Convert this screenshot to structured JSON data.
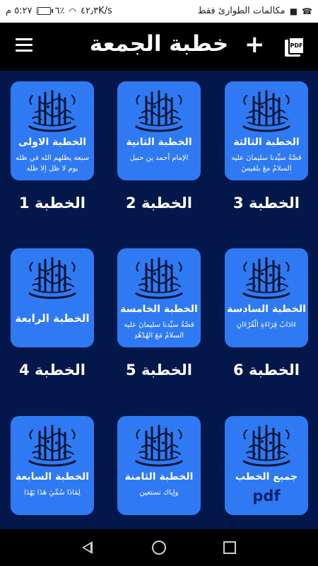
{
  "status_bar": {
    "carrier_text": "مكالمات الطوارئ فقط",
    "speed": "٤٢٫٣K/s",
    "battery": "٦٪",
    "battery_level": 0.06,
    "time": "٥:٢٧ م"
  },
  "app_bar": {
    "title": "خطبة الجمعة",
    "plus_label": "+",
    "pdf_label": "PDF"
  },
  "cards": [
    {
      "title": "الخطبة الاولى",
      "subtitle": "سبعة يظلهم الله في ظله يوم لا ظل إلا ظله",
      "caption": "الخطبة 1"
    },
    {
      "title": "الخطبة الثانية",
      "subtitle": "الإمام أحمد بن حنبل",
      "caption": "الخطبة 2"
    },
    {
      "title": "الخطبة الثالثة",
      "subtitle": "قصَّةُ سيِّدنا سليمانَ عليه السلامُ معَ بلقيسَ",
      "caption": "الخطبة 3"
    },
    {
      "title": "الخطبة الرابعة",
      "subtitle": "",
      "caption": "الخطبة 4"
    },
    {
      "title": "الخطبة الخامسة",
      "subtitle": "قصَّةُ سيِّدنا سليمانَ عليه السلامُ مَعَ الهُدْهُدِ",
      "caption": "الخطبة 5"
    },
    {
      "title": "الخطبة السادسة",
      "subtitle": "ءَادَابُ قِرَاءَةِ الْقُرْءَانِ",
      "caption": "الخطبة 6"
    },
    {
      "title": "الخطبة السابعة",
      "subtitle": "لِمَاذَا سُمِّيَ هَذَا يَهْدَا",
      "caption": ""
    },
    {
      "title": "الخطبة الثامنة",
      "subtitle": "وإياك نستعين",
      "caption": ""
    },
    {
      "title": "جميع الخطب",
      "subtitle": "pdf",
      "caption": ""
    }
  ]
}
